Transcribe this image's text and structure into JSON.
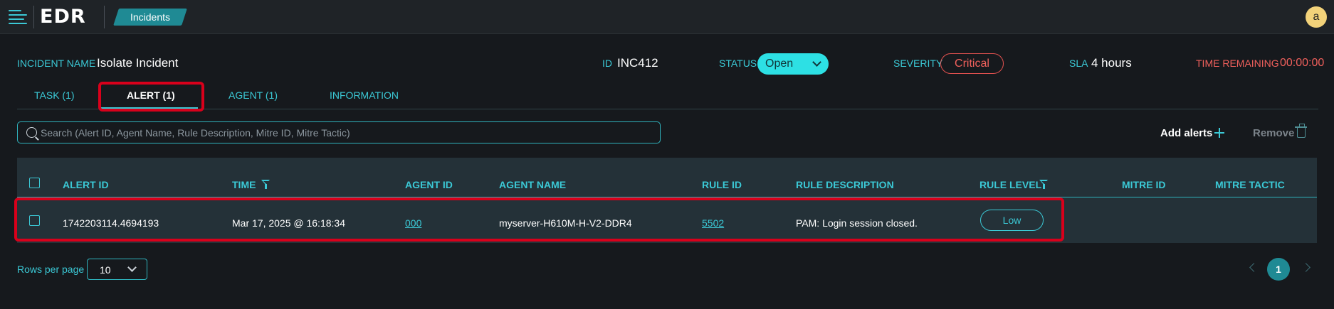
{
  "app": {
    "logo": "EDR",
    "breadcrumb": "Incidents",
    "avatar_initial": "a"
  },
  "incident": {
    "name_label": "INCIDENT NAME",
    "name": "Isolate Incident",
    "id_label": "ID",
    "id": "INC412",
    "status_label": "STATUS",
    "status": "Open",
    "severity_label": "SEVERITY",
    "severity": "Critical",
    "sla_label": "SLA",
    "sla": "4 hours",
    "time_remaining_label": "TIME REMAINING",
    "time_remaining": "00:00:00"
  },
  "tabs": [
    {
      "label": "TASK (1)",
      "active": false
    },
    {
      "label": "ALERT (1)",
      "active": true
    },
    {
      "label": "AGENT (1)",
      "active": false
    },
    {
      "label": "INFORMATION",
      "active": false
    }
  ],
  "search": {
    "placeholder": "Search (Alert ID, Agent Name, Rule Description, Mitre ID, Mitre Tactic)",
    "value": ""
  },
  "actions": {
    "add_label": "Add alerts",
    "remove_label": "Remove"
  },
  "table": {
    "columns": [
      "ALERT ID",
      "TIME",
      "AGENT ID",
      "AGENT NAME",
      "RULE ID",
      "RULE DESCRIPTION",
      "RULE LEVEL",
      "MITRE ID",
      "MITRE TACTIC"
    ],
    "rows": [
      {
        "alert_id": "1742203114.4694193",
        "time": "Mar 17, 2025 @ 16:18:34",
        "agent_id": "000",
        "agent_name": "myserver-H610M-H-V2-DDR4",
        "rule_id": "5502",
        "rule_description": "PAM: Login session closed.",
        "rule_level": "Low",
        "mitre_id": "",
        "mitre_tactic": ""
      }
    ]
  },
  "pagination": {
    "rows_per_page_label": "Rows per page",
    "rows_per_page": "10",
    "current_page": "1"
  },
  "colors": {
    "accent": "#3bc9d6",
    "critical": "#f0605c",
    "highlight": "#d9001b",
    "status_pill": "#2de0e4"
  }
}
